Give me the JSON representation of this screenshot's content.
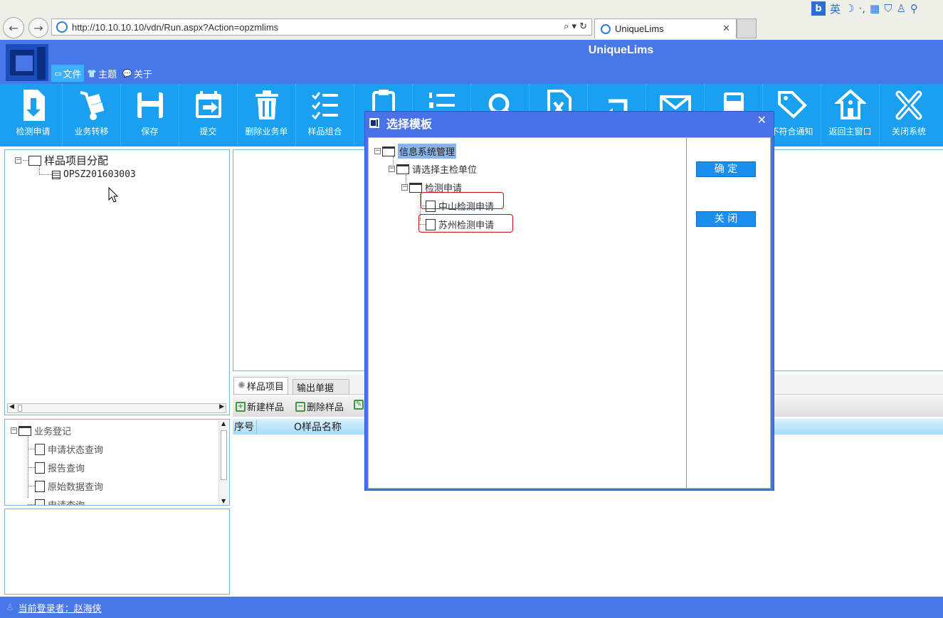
{
  "browser": {
    "url": "http://10.10.10.10/vdn/Run.aspx?Action=opzmlims",
    "tab_title": "UniqueLims",
    "tab_close": "✕",
    "url_tools": "⌕ ▾ ↻",
    "ime": {
      "logo": "b",
      "lang": "英"
    }
  },
  "app": {
    "title": "UniqueLims",
    "menu": [
      {
        "label": "文件",
        "icon": "▭"
      },
      {
        "label": "主题",
        "icon": "👕"
      },
      {
        "label": "关于",
        "icon": "💬"
      }
    ],
    "toolbar": [
      {
        "label": "检测申请",
        "icon": "download-doc-icon"
      },
      {
        "label": "业务转移",
        "icon": "hand-truck-icon"
      },
      {
        "label": "保存",
        "icon": "save-icon"
      },
      {
        "label": "提交",
        "icon": "calendar-arrow-icon"
      },
      {
        "label": "删除业务单",
        "icon": "trash-icon"
      },
      {
        "label": "样品组合",
        "icon": "checklist-icon"
      },
      {
        "label": "",
        "icon": "clipboard-icon"
      },
      {
        "label": "",
        "icon": "numbered-list-icon"
      },
      {
        "label": "",
        "icon": "search-icon"
      },
      {
        "label": "",
        "icon": "excel-doc-icon"
      },
      {
        "label": "",
        "icon": "return-arrow-icon"
      },
      {
        "label": "",
        "icon": "mail-icon"
      },
      {
        "label": "",
        "icon": "calculator-icon"
      },
      {
        "label": "不符合通知",
        "icon": "tag-icon"
      },
      {
        "label": "返回主窗口",
        "icon": "home-icon"
      },
      {
        "label": "关闭系统",
        "icon": "close-x-icon"
      }
    ]
  },
  "left_tree": {
    "root": "样品项目分配",
    "child": "OPSZ201603003"
  },
  "biz_tree": {
    "root": "业务登记",
    "items": [
      "申请状态查询",
      "报告查询",
      "原始数据查询",
      "申请查询"
    ]
  },
  "tabs": [
    "样品项目",
    "输出单据"
  ],
  "sub_toolbar": {
    "new_sample": "新建样品",
    "delete_sample": "删除样品"
  },
  "grid": {
    "col_seq": "序号",
    "col_name": "O样品名称"
  },
  "status": {
    "login": "当前登录者：赵海侠"
  },
  "modal": {
    "title": "选择模板",
    "close": "✕",
    "tree": {
      "root": "信息系统管理",
      "level1": "请选择主检单位",
      "level2": "检测申请",
      "leaves": [
        "中山检测申请",
        "苏州检测申请"
      ]
    },
    "confirm": "确 定",
    "close_button": "关 闭"
  },
  "colors": {
    "header": "#4878e8",
    "toolbar": "#1aa0f0",
    "modal": "#4a72e8",
    "button": "#1a8ff0",
    "highlight": "#d01010"
  }
}
